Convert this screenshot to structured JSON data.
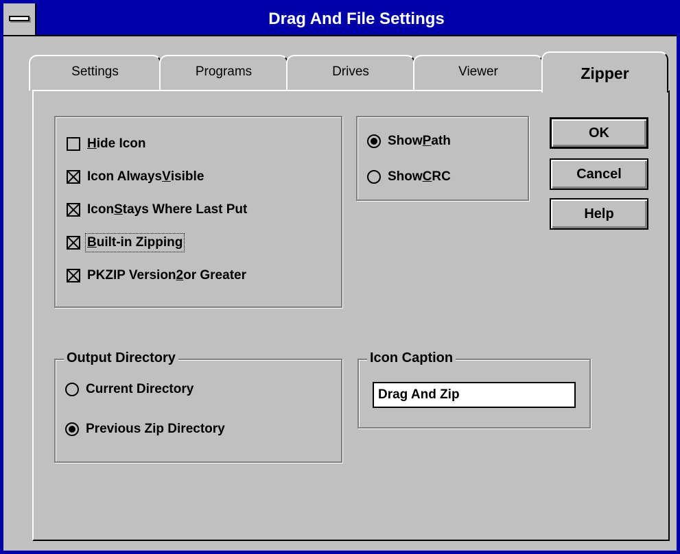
{
  "window": {
    "title": "Drag And File Settings",
    "colors": {
      "title_bar": "#0000a8",
      "face": "#c0c0c0"
    }
  },
  "tabs": [
    {
      "label": "Settings",
      "active": false
    },
    {
      "label": "Programs",
      "active": false
    },
    {
      "label": "Drives",
      "active": false
    },
    {
      "label": "Viewer",
      "active": false
    },
    {
      "label": "Zipper",
      "active": true
    }
  ],
  "options": {
    "hide_icon": {
      "label_pre": "",
      "mnemonic": "H",
      "label_post": "ide Icon",
      "checked": false
    },
    "icon_always_visible": {
      "label_pre": "Icon Always ",
      "mnemonic": "V",
      "label_post": "isible",
      "checked": true
    },
    "icon_stays": {
      "label_pre": "Icon ",
      "mnemonic": "S",
      "label_post": "tays Where Last Put",
      "checked": true
    },
    "builtin_zipping": {
      "label_pre": "",
      "mnemonic": "B",
      "label_post": "uilt-in Zipping",
      "checked": true
    },
    "pkzip_v2": {
      "label_pre": "PKZIP Version ",
      "mnemonic": "2",
      "label_post": " or Greater",
      "checked": true
    }
  },
  "display": {
    "show_path": {
      "label_pre": "Show ",
      "mnemonic": "P",
      "label_post": "ath",
      "selected": true
    },
    "show_crc": {
      "label_pre": "Show ",
      "mnemonic": "C",
      "label_post": "RC",
      "selected": false
    }
  },
  "buttons": {
    "ok": "OK",
    "cancel": "Cancel",
    "help": "Help"
  },
  "output_directory": {
    "title": "Output Directory",
    "current": {
      "label": "Current Directory",
      "selected": false
    },
    "previous": {
      "label": "Previous Zip Directory",
      "selected": true
    }
  },
  "icon_caption": {
    "title": "Icon Caption",
    "value": "Drag And Zip"
  }
}
